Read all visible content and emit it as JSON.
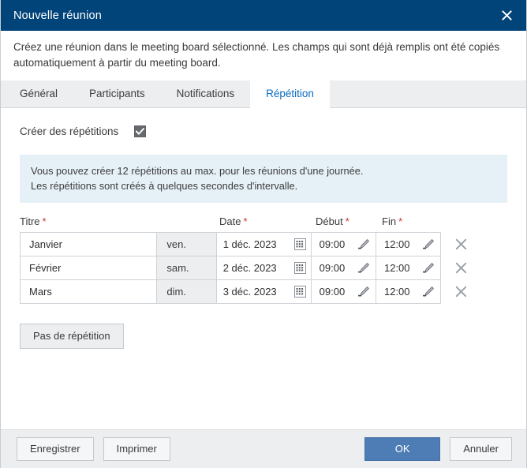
{
  "window": {
    "title": "Nouvelle réunion",
    "close_icon": "close-icon"
  },
  "description": "Créez une réunion dans le meeting board sélectionné. Les champs qui sont déjà remplis ont été copiés automatiquement à partir du meeting board.",
  "tabs": [
    {
      "label": "Général",
      "active": false
    },
    {
      "label": "Participants",
      "active": false
    },
    {
      "label": "Notifications",
      "active": false
    },
    {
      "label": "Répétition",
      "active": true
    }
  ],
  "checkbox": {
    "label": "Créer des répétitions",
    "checked": true
  },
  "info": {
    "line1": "Vous pouvez créer 12 répétitions au max. pour les réunions d'une journée.",
    "line2": "Les répétitions sont créés à quelques secondes d'intervalle."
  },
  "table": {
    "headers": {
      "title": "Titre",
      "date": "Date",
      "start": "Début",
      "end": "Fin",
      "required_marker": "*"
    },
    "rows": [
      {
        "title": "Janvier",
        "day": "ven.",
        "date": "1 déc. 2023",
        "start": "09:00",
        "end": "12:00",
        "calendar_icon": "calendar-icon",
        "start_edit_icon": "pencil-icon",
        "end_edit_icon": "pencil-icon",
        "delete_icon": "close-icon"
      },
      {
        "title": "Février",
        "day": "sam.",
        "date": "2 déc. 2023",
        "start": "09:00",
        "end": "12:00",
        "calendar_icon": "calendar-icon",
        "start_edit_icon": "pencil-icon",
        "end_edit_icon": "pencil-icon",
        "delete_icon": "close-icon"
      },
      {
        "title": "Mars",
        "day": "dim.",
        "date": "3 déc. 2023",
        "start": "09:00",
        "end": "12:00",
        "calendar_icon": "calendar-icon",
        "start_edit_icon": "pencil-icon",
        "end_edit_icon": "pencil-icon",
        "delete_icon": "close-icon"
      }
    ]
  },
  "no_repetition_button": "Pas de répétition",
  "footer": {
    "save": "Enregistrer",
    "print": "Imprimer",
    "ok": "OK",
    "cancel": "Annuler"
  },
  "colors": {
    "titlebar": "#014479",
    "accent_tab": "#0a6cc0",
    "primary_button": "#4e7cb5",
    "info_background": "#e6f1f7",
    "required": "#c0392b"
  }
}
